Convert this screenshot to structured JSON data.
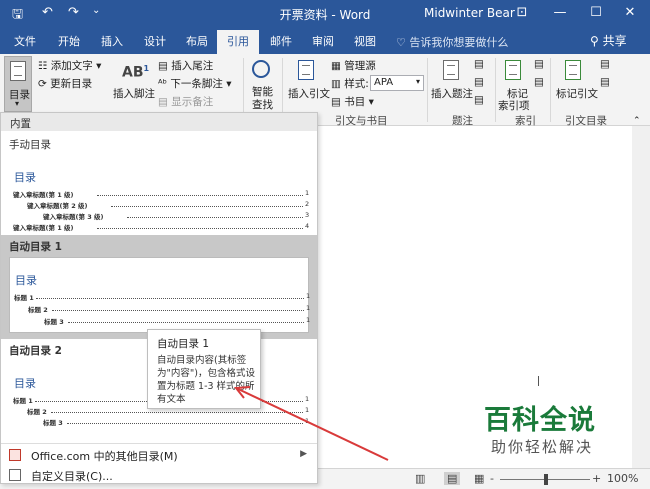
{
  "window": {
    "title": "开票资料 - Word",
    "user": "Midwinter Bear",
    "qa": {
      "save": "🖫",
      "undo": "↶",
      "redo": "↷",
      "customize": "⌄"
    },
    "controls": {
      "ribbon_opts": "⊡",
      "minimize": "—",
      "maximize": "☐",
      "close": "✕"
    }
  },
  "tabs": [
    "文件",
    "开始",
    "插入",
    "设计",
    "布局",
    "引用",
    "邮件",
    "审阅",
    "视图"
  ],
  "active_tab": "引用",
  "tell_me": "告诉我你想要做什么",
  "share": "共享",
  "ribbon": {
    "toc_btn": "目录",
    "add_text": "添加文字",
    "update_toc": "更新目录",
    "insert_footnote": "插入脚注",
    "ab_icon": "AB",
    "ab_sup": "1",
    "insert_endnote": "插入尾注",
    "next_footnote": "下一条脚注",
    "show_notes": "显示备注",
    "smart_lookup_1": "智能",
    "smart_lookup_2": "查找",
    "insert_citation": "插入引文",
    "manage_sources": "管理源",
    "style_label": "样式:",
    "style_value": "APA",
    "bibliography": "书目",
    "group_citations": "引文与书目",
    "insert_caption": "插入题注",
    "group_captions": "题注",
    "mark_entry_1": "标记",
    "mark_entry_2": "索引项",
    "group_index": "索引",
    "mark_citation": "标记引文",
    "group_toa": "引文目录"
  },
  "panel": {
    "header": "内置",
    "manual_title": "手动目录",
    "manual_toc_heading": "目录",
    "manual_lines": [
      {
        "text": "键入章标题(第 1 级)",
        "page": "1"
      },
      {
        "text": "键入章标题(第 2 级)",
        "page": "2"
      },
      {
        "text": "键入章标题(第 3 级)",
        "page": "3"
      },
      {
        "text": "键入章标题(第 1 级)",
        "page": "4"
      }
    ],
    "auto1_title": "自动目录 1",
    "auto1_heading": "目录",
    "auto1_lines": [
      {
        "text": "标题 1",
        "page": "1"
      },
      {
        "text": "标题 2",
        "page": "1"
      },
      {
        "text": "标题 3",
        "page": "1"
      }
    ],
    "auto2_title": "自动目录 2",
    "auto2_heading": "目录",
    "auto2_lines": [
      {
        "text": "标题 1",
        "page": "1"
      },
      {
        "text": "标题 2",
        "page": "1"
      },
      {
        "text": "标题 3",
        "page": "1"
      }
    ],
    "more_toc": "Office.com 中的其他目录(M)",
    "custom_toc": "自定义目录(C)..."
  },
  "tooltip": {
    "title": "自动目录 1",
    "body": "自动目录内容(其标签为\"内容\")，包含格式设置为标题 1-3 样式的所有文本"
  },
  "status": {
    "zoom": "100%",
    "zoom_minus": "-",
    "zoom_plus": "+"
  },
  "watermark": {
    "line1": "百科全说",
    "line2": "助你轻松解决"
  },
  "colors": {
    "accent": "#2b579a",
    "arrow": "#d93a3a"
  }
}
